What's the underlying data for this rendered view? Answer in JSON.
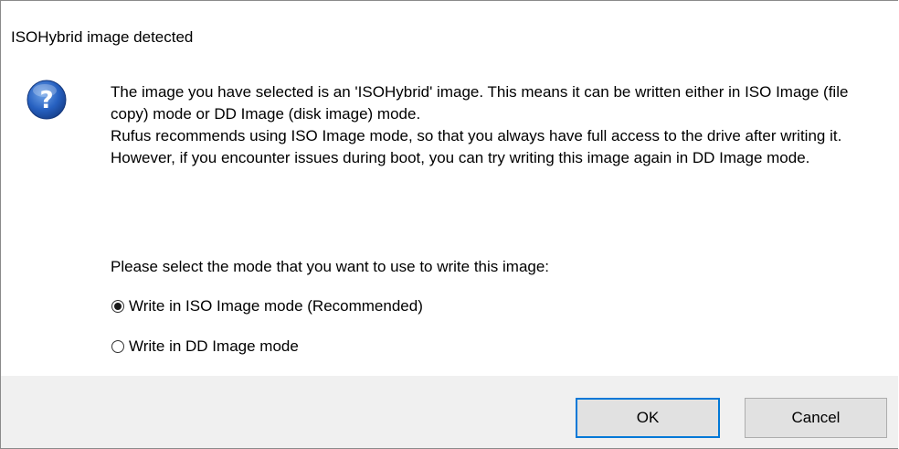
{
  "dialog": {
    "title": "ISOHybrid image detected",
    "icon": "question-icon",
    "message_lines": [
      "The image you have selected is an 'ISOHybrid' image. This means it can be written either in ISO Image (file copy) mode or DD Image (disk image) mode.",
      "Rufus recommends using ISO Image mode, so that you always have full access to the drive after writing it.",
      "However, if you encounter issues during boot, you can try writing this image again in DD Image mode."
    ],
    "prompt": "Please select the mode that you want to use to write this image:",
    "options": [
      {
        "label": "Write in ISO Image mode (Recommended)",
        "selected": true
      },
      {
        "label": "Write in DD Image mode",
        "selected": false
      }
    ],
    "buttons": {
      "ok": "OK",
      "cancel": "Cancel"
    }
  },
  "colors": {
    "footer_bg": "#f0f0f0",
    "default_button_border": "#0078d7",
    "icon_blue": "#1f5fb8"
  }
}
